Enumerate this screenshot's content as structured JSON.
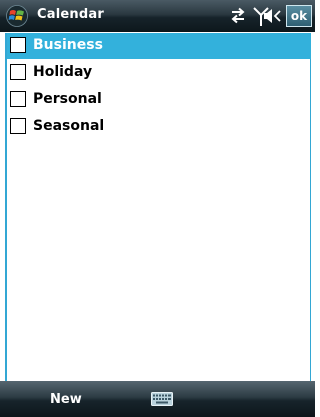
{
  "titlebar": {
    "title": "Calendar",
    "icons": [
      "windows-start-icon",
      "connectivity-icon",
      "signal-icon",
      "volume-icon"
    ],
    "ok_label": "ok"
  },
  "categories": {
    "items": [
      {
        "label": "Business",
        "checked": false,
        "selected": true
      },
      {
        "label": "Holiday",
        "checked": false,
        "selected": false
      },
      {
        "label": "Personal",
        "checked": false,
        "selected": false
      },
      {
        "label": "Seasonal",
        "checked": false,
        "selected": false
      }
    ]
  },
  "menubar": {
    "left_softkey": "New",
    "center_icon": "keyboard-icon"
  },
  "colors": {
    "selection": "#33b1dc",
    "list_border": "#33a7d4",
    "bar_dark": "#16232a"
  }
}
